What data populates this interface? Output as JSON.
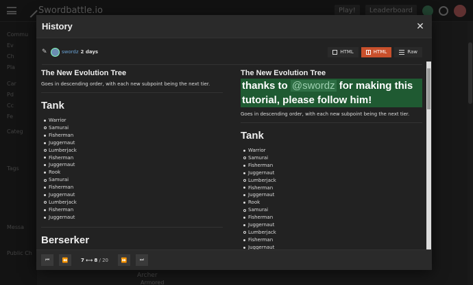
{
  "background": {
    "site_name": "Swordbattle.io",
    "header_buttons": [
      "Play!",
      "Leaderboard"
    ],
    "sidebar_items": [
      "Commu",
      "Ev",
      "Ch",
      "Pla",
      "Car",
      "Pd",
      "Cc",
      "Fe",
      "Categ",
      "Tags",
      "Messa",
      "Public Ch"
    ],
    "bottom_text": "Archer",
    "bottom_sub": "Armored"
  },
  "modal": {
    "title": "History",
    "author": "swordz",
    "time_ago": "2 days",
    "view_buttons": [
      {
        "label": "HTML",
        "icon": "square-icon",
        "active": false
      },
      {
        "label": "HTML",
        "icon": "split-icon",
        "active": true
      },
      {
        "label": "Raw",
        "icon": "raw-icon",
        "active": false
      }
    ],
    "left": {
      "title": "The New Evolution Tree",
      "description": "Goes in descending order, with each new subpoint being the next tier.",
      "section": "Tank",
      "items": [
        {
          "text": "Warrior",
          "sub": false
        },
        {
          "text": "Samurai",
          "sub": true
        },
        {
          "text": "Fisherman",
          "sub": false
        },
        {
          "text": "Juggernaut",
          "sub": false
        },
        {
          "text": "Lumberjack",
          "sub": true
        },
        {
          "text": "Fisherman",
          "sub": false
        },
        {
          "text": "Juggernaut",
          "sub": false
        },
        {
          "text": "Rook",
          "sub": false
        },
        {
          "text": "Samurai",
          "sub": true
        },
        {
          "text": "Fisherman",
          "sub": false
        },
        {
          "text": "Juggernaut",
          "sub": false
        },
        {
          "text": "Lumberjack",
          "sub": true
        },
        {
          "text": "Fisherman",
          "sub": false
        },
        {
          "text": "Juggernaut",
          "sub": false
        }
      ],
      "section2": "Berserker"
    },
    "right": {
      "title": "The New Evolution Tree",
      "thanks_before": "thanks to ",
      "mention": "@swordz",
      "thanks_after": " for making this tutorial, please follow him!",
      "description": "Goes in descending order, with each new subpoint being the next tier.",
      "section": "Tank",
      "items": [
        {
          "text": "Warrior",
          "sub": false
        },
        {
          "text": "Samurai",
          "sub": true
        },
        {
          "text": "Fisherman",
          "sub": false
        },
        {
          "text": "Juggernaut",
          "sub": false
        },
        {
          "text": "Lumberjack",
          "sub": true
        },
        {
          "text": "Fisherman",
          "sub": false
        },
        {
          "text": "Juggernaut",
          "sub": false
        },
        {
          "text": "Rook",
          "sub": false
        },
        {
          "text": "Samurai",
          "sub": true
        },
        {
          "text": "Fisherman",
          "sub": false
        },
        {
          "text": "Juggernaut",
          "sub": false
        },
        {
          "text": "Lumberjack",
          "sub": true
        },
        {
          "text": "Fisherman",
          "sub": false
        },
        {
          "text": "Juggernaut",
          "sub": false
        }
      ]
    },
    "revision": {
      "from": "7",
      "arrow": "⟷",
      "to": "8",
      "total": "/ 20"
    }
  }
}
